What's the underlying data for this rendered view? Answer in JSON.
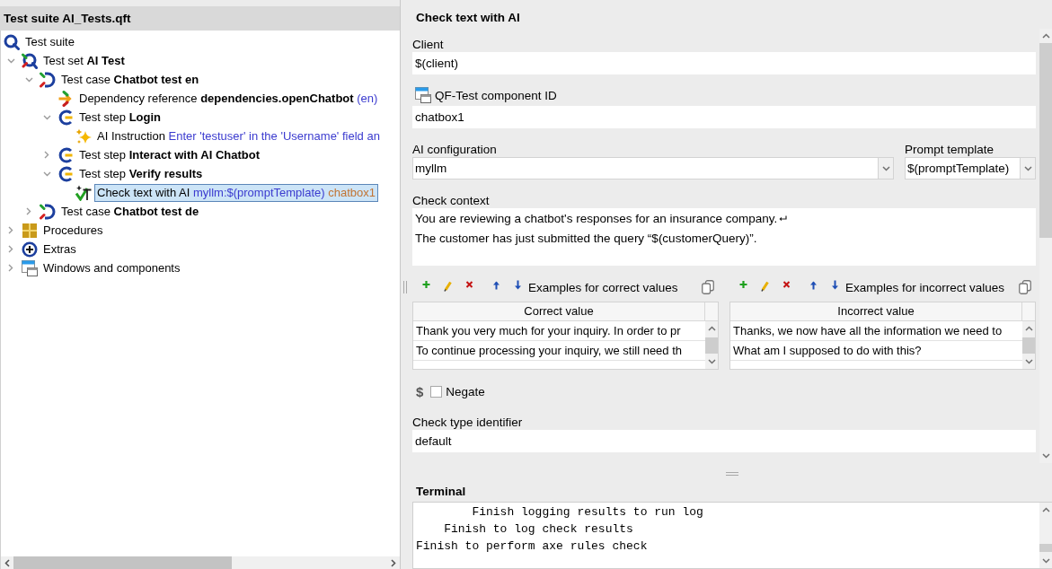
{
  "tree_panel": {
    "title": "Test suite AI_Tests.qft",
    "tree": [
      {
        "kind": "suite",
        "label": "Test suite",
        "selected": false,
        "children": [
          {
            "kind": "test-set",
            "label": "Test set",
            "name": "AI Test",
            "expanded": true,
            "selected": false,
            "children": [
              {
                "kind": "test-case",
                "label": "Test case",
                "name": "Chatbot test en",
                "expanded": true,
                "selected": false,
                "children": [
                  {
                    "kind": "dependency",
                    "label": "Dependency reference",
                    "name": "dependencies.openChatbot",
                    "detail": "(en)",
                    "selected": false
                  },
                  {
                    "kind": "test-step",
                    "label": "Test step",
                    "name": "Login",
                    "expanded": true,
                    "selected": false,
                    "children": [
                      {
                        "kind": "ai-instruction",
                        "label": "AI Instruction",
                        "detail": "Enter 'testuser' in the 'Username' field an",
                        "selected": false
                      }
                    ]
                  },
                  {
                    "kind": "test-step",
                    "label": "Test step",
                    "name": "Interact with AI Chatbot",
                    "expanded": false,
                    "selected": false
                  },
                  {
                    "kind": "test-step",
                    "label": "Test step",
                    "name": "Verify results",
                    "expanded": true,
                    "selected": false,
                    "children": [
                      {
                        "kind": "ai-check",
                        "label": "Check text with AI",
                        "detail": "myllm:$(promptTemplate)",
                        "component": "chatbox1",
                        "selected": true
                      }
                    ]
                  }
                ]
              },
              {
                "kind": "test-case",
                "label": "Test case",
                "name": "Chatbot test de",
                "expanded": false,
                "selected": false
              }
            ]
          },
          {
            "kind": "procedures",
            "label": "Procedures",
            "expanded": false,
            "selected": false
          },
          {
            "kind": "extras",
            "label": "Extras",
            "expanded": false,
            "selected": false
          },
          {
            "kind": "windows",
            "label": "Windows and components",
            "expanded": false,
            "selected": false
          }
        ]
      }
    ]
  },
  "editor": {
    "title": "Check text with AI",
    "client": {
      "label": "Client",
      "value": "$(client)"
    },
    "component_id": {
      "label": "QF-Test component ID",
      "value": "chatbox1"
    },
    "ai_configuration": {
      "label": "AI configuration",
      "value": "myllm"
    },
    "prompt_template": {
      "label": "Prompt template",
      "value": "$(promptTemplate)"
    },
    "check_context": {
      "label": "Check context",
      "lines": [
        "You are reviewing a chatbot's responses for an insurance company.",
        "The customer has just submitted the query “$(customerQuery)”."
      ]
    },
    "examples": [
      {
        "title": "Examples for correct values",
        "column": "Correct value",
        "rows": [
          "Thank you very much for your inquiry. In order to pr",
          "To continue processing your inquiry, we still need th"
        ]
      },
      {
        "title": "Examples for incorrect values",
        "column": "Incorrect value",
        "rows": [
          "Thanks, we now have all the information we need to",
          "What am I supposed to do with this?"
        ]
      }
    ],
    "negate": {
      "marker": "$",
      "label": "Negate",
      "checked": false
    },
    "check_type_identifier": {
      "label": "Check type identifier",
      "value": "default"
    }
  },
  "terminal": {
    "title": "Terminal",
    "lines": [
      "        Finish logging results to run log",
      "    Finish to log check results",
      "Finish to perform axe rules check"
    ]
  }
}
